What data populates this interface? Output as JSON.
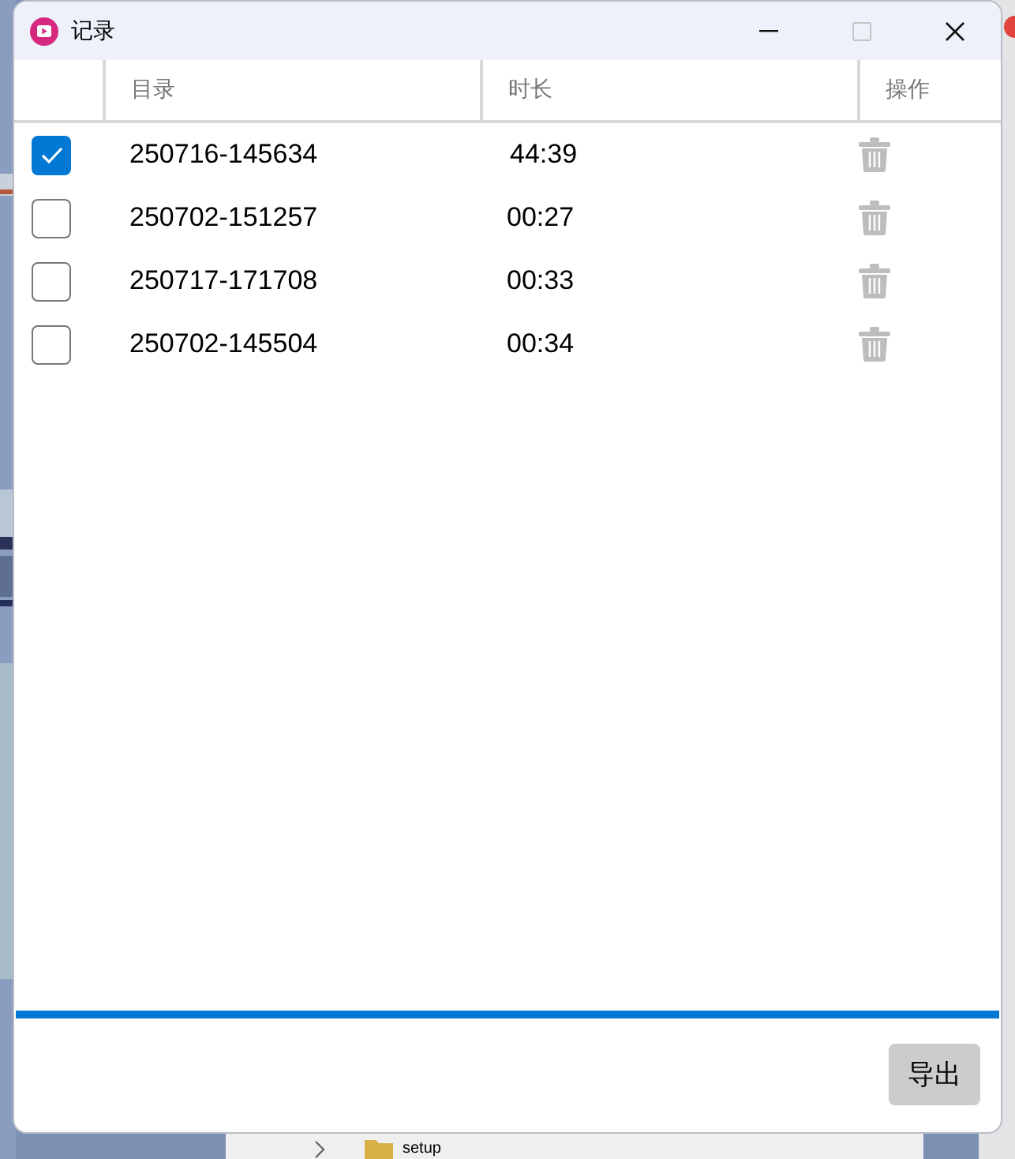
{
  "window": {
    "title": "记录",
    "controls": [
      {
        "kind": "minimize",
        "disabled": false
      },
      {
        "kind": "maximize",
        "disabled": true
      },
      {
        "kind": "close",
        "disabled": false
      }
    ]
  },
  "table": {
    "columns": [
      {
        "label": "目录"
      },
      {
        "label": "时长"
      },
      {
        "label": "操作"
      }
    ],
    "rows": [
      {
        "checked": true,
        "name": "250716-145634",
        "duration": "44:39"
      },
      {
        "checked": false,
        "name": "250702-151257",
        "duration": "00:27"
      },
      {
        "checked": false,
        "name": "250717-171708",
        "duration": "00:33"
      },
      {
        "checked": false,
        "name": "250702-145504",
        "duration": "00:34"
      }
    ]
  },
  "progress": {
    "level": 1
  },
  "buttons": [
    {
      "label": "导出"
    }
  ],
  "background_window": {
    "items": [
      {
        "label": "setup"
      }
    ]
  }
}
